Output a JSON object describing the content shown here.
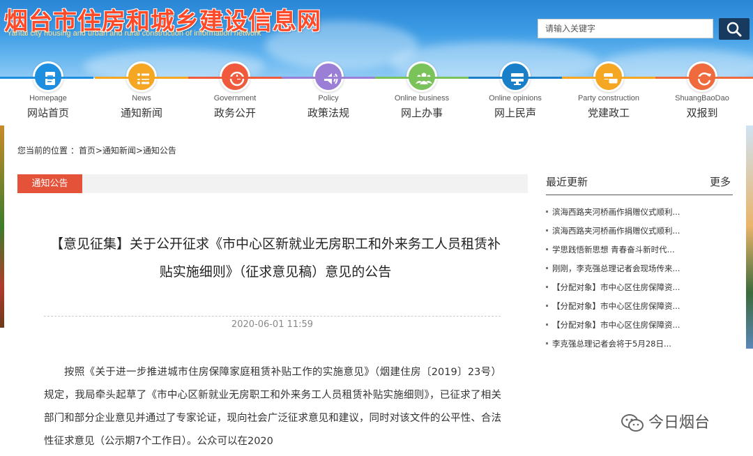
{
  "site": {
    "title_cn": "烟台市住房和城乡建设信息网",
    "title_en": "Yantai city housing and urban and rural construction of information network"
  },
  "search": {
    "placeholder": "请输入关键字"
  },
  "nav": [
    {
      "en": "Homepage",
      "cn": "网站首页",
      "icon": "document-icon",
      "color": "#1e8fe0",
      "bar": "#1e8fe0"
    },
    {
      "en": "News",
      "cn": "通知新闻",
      "icon": "list-icon",
      "color": "#f5a623",
      "bar": "#f5a623"
    },
    {
      "en": "Government",
      "cn": "政务公开",
      "icon": "clock-icon",
      "color": "#ef5b3c",
      "bar": "#ef5b3c"
    },
    {
      "en": "Policy",
      "cn": "政策法规",
      "icon": "speaker-icon",
      "color": "#9b7fd6",
      "bar": "#9b7fd6"
    },
    {
      "en": "Online business",
      "cn": "网上办事",
      "icon": "people-icon",
      "color": "#7ac35a",
      "bar": "#7ac35a"
    },
    {
      "en": "Online opinions",
      "cn": "网上民声",
      "icon": "monitor-icon",
      "color": "#1a7fc9",
      "bar": "#1a7fc9"
    },
    {
      "en": "Party construction",
      "cn": "党建政工",
      "icon": "chat-icon",
      "color": "#f5a623",
      "bar": "#f5a623"
    },
    {
      "en": "ShuangBaoDao",
      "cn": "双报到",
      "icon": "refresh-icon",
      "color": "#ef6a3c",
      "bar": "#ef6a3c"
    }
  ],
  "breadcrumb": "您当前的位置 ：首页>通知新闻>通知公告",
  "section": {
    "tab": "通知公告"
  },
  "article": {
    "title": "【意见征集】关于公开征求《市中心区新就业无房职工和外来务工人员租赁补贴实施细则》（征求意见稿）意见的公告",
    "date": "2020-06-01 11:59",
    "body": "按照《关于进一步推进城市住房保障家庭租赁补贴工作的实施意见》（烟建住房〔2019〕23号）规定，我局牵头起草了《市中心区新就业无房职工和外来务工人员租赁补贴实施细则》，已征求了相关部门和部分企业意见并通过了专家论证，现向社会广泛征求意见和建议，同时对该文件的公平性、合法性征求意见（公示期7个工作日）。公众可以在2020"
  },
  "sidebar": {
    "title": "最近更新",
    "more": "更多",
    "items": [
      "滨海西路夹河桥画作捐赠仪式顺利...",
      "滨海西路夹河桥画作捐赠仪式顺利...",
      "学思践悟新思想 青春奋斗新时代...",
      "刚刚，李克强总理记者会现场传来...",
      "【分配对象】市中心区住房保障资...",
      "【分配对象】市中心区住房保障资...",
      "【分配对象】市中心区住房保障资...",
      "李克强总理记者会将于5月28日..."
    ]
  },
  "watermark": {
    "text": "今日烟台"
  },
  "colors": {
    "accent": "#e5523a",
    "header_top": "#2a86d6",
    "search_button": "#173a5e"
  }
}
